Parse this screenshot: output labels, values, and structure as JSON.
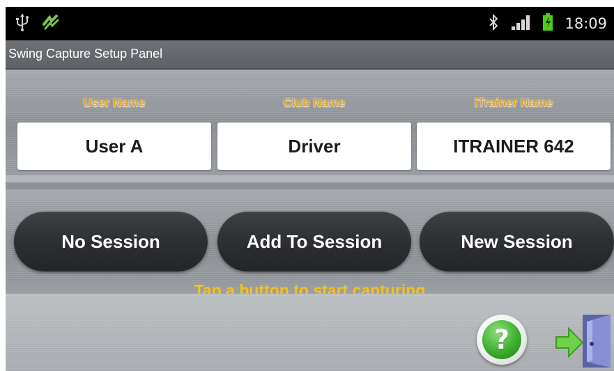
{
  "status_bar": {
    "time": "18:09",
    "icons": [
      "usb-icon",
      "sync-icon",
      "bluetooth-icon",
      "signal-icon",
      "battery-icon"
    ],
    "battery_color": "#4ccb1a"
  },
  "app": {
    "title": "Swing Capture Setup Panel"
  },
  "fields": [
    {
      "label": "User Name",
      "value": "User A"
    },
    {
      "label": "Club Name",
      "value": "Driver"
    },
    {
      "label": "iTrainer Name",
      "value": "ITRAINER 642"
    }
  ],
  "session_buttons": [
    {
      "label": "No Session"
    },
    {
      "label": "Add To Session"
    },
    {
      "label": "New Session"
    }
  ],
  "hint": "Tap a button to start capturing",
  "footer": {
    "help_icon": "question-mark-icon",
    "help_glyph": "?",
    "exit_icon": "exit-door-icon"
  },
  "colors": {
    "label_color": "#e0a21e",
    "hint_color": "#f3c11c",
    "help_green": "#3fae2e",
    "exit_door": "#7f88c9",
    "exit_arrow": "#6fd04a"
  }
}
